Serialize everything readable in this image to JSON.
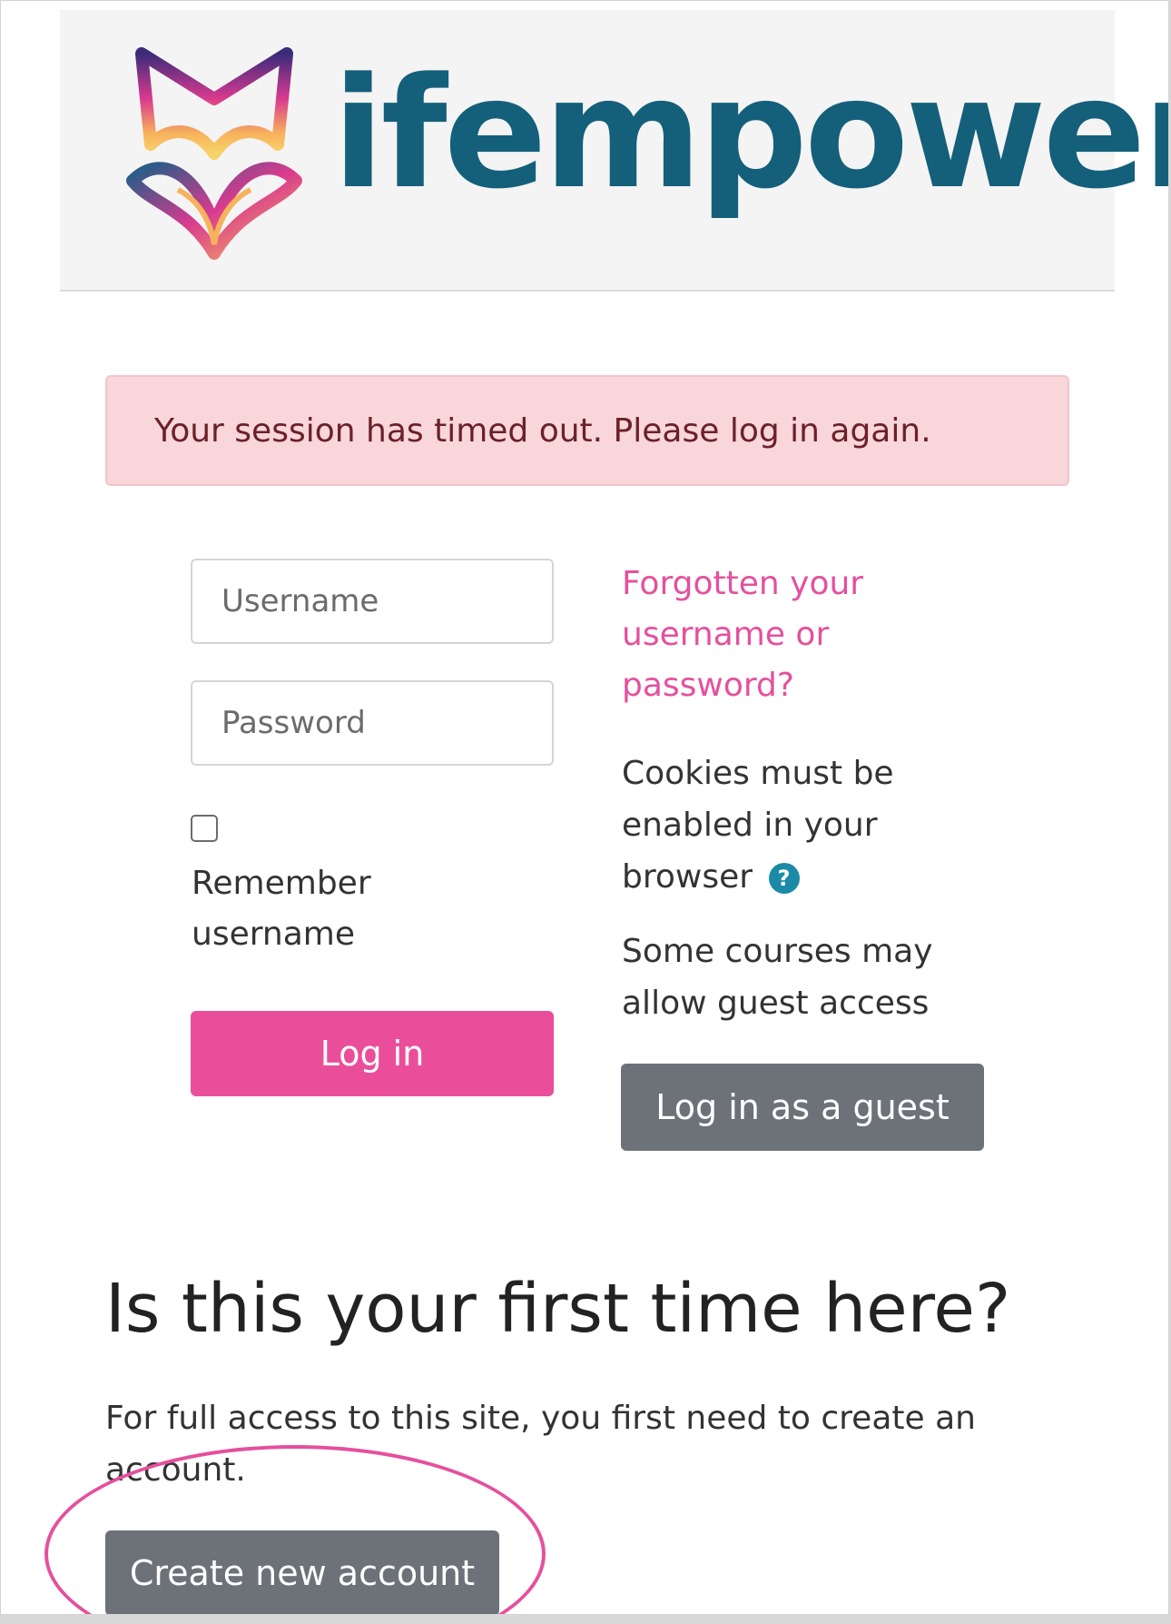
{
  "brand": {
    "name": "ifempower",
    "text_color": "#145f7a"
  },
  "alert": {
    "message": "Your session has timed out. Please log in again."
  },
  "login_form": {
    "username_placeholder": "Username",
    "password_placeholder": "Password",
    "remember_label": "Remember username",
    "login_button": "Log in",
    "login_button_color": "#ea4e9b"
  },
  "sidebar": {
    "forgot_link": "Forgotten your username or password?",
    "cookies_text": "Cookies must be enabled in your browser",
    "help_icon": "question-circle-icon",
    "guest_text": "Some courses may allow guest access",
    "guest_button": "Log in as a guest"
  },
  "signup": {
    "heading": "Is this your first time here?",
    "text": "For full access to this site, you first need to create an account.",
    "create_button": "Create new account"
  },
  "annotation": {
    "highlight_color": "#e5509d"
  }
}
